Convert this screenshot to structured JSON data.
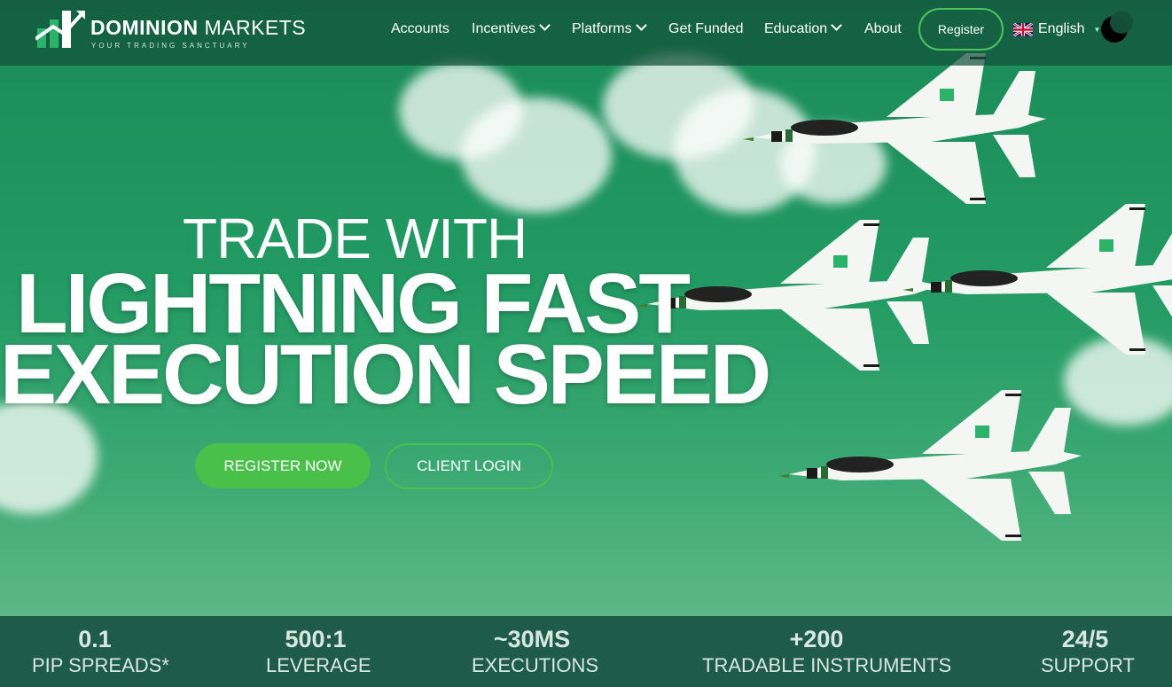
{
  "brand": {
    "name_bold": "DOMINION",
    "name_light": " MARKETS",
    "tagline": "YOUR TRADING SANCTUARY"
  },
  "nav": {
    "items": [
      {
        "label": "Accounts",
        "dropdown": false
      },
      {
        "label": "Incentives",
        "dropdown": true
      },
      {
        "label": "Platforms",
        "dropdown": true
      },
      {
        "label": "Get Funded",
        "dropdown": false
      },
      {
        "label": "Education",
        "dropdown": true
      },
      {
        "label": "About",
        "dropdown": false
      }
    ],
    "register_label": "Register",
    "language_label": "English"
  },
  "hero": {
    "line1": "TRADE WITH",
    "line2": "LIGHTNING FAST",
    "line3": "EXECUTION SPEED",
    "register_now_label": "REGISTER NOW",
    "client_login_label": "CLIENT LOGIN"
  },
  "stats": [
    {
      "value": "0.1",
      "label": "PIP SPREADS*"
    },
    {
      "value": "500:1",
      "label": "LEVERAGE"
    },
    {
      "value": "~30MS",
      "label": "EXECUTIONS"
    },
    {
      "value": "+200",
      "label": "TRADABLE INSTRUMENTS"
    },
    {
      "value": "24/5",
      "label": "SUPPORT"
    }
  ],
  "colors": {
    "accent_green": "#48c04a",
    "header_bg": "#14503c",
    "stats_bg": "#1e5b49"
  }
}
